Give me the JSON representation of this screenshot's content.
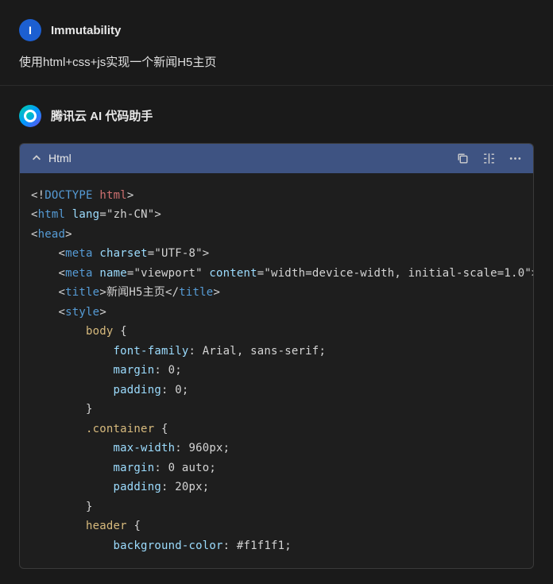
{
  "user": {
    "avatar_letter": "I",
    "name": "Immutability",
    "message": "使用html+css+js实现一个新闻H5主页"
  },
  "ai": {
    "name": "腾讯云 AI 代码助手"
  },
  "code_block": {
    "language": "Html",
    "lines": [
      {
        "indent": 0,
        "tokens": [
          [
            "tag-bracket",
            "<!"
          ],
          [
            "tag-name",
            "DOCTYPE"
          ],
          [
            "text-content",
            " "
          ],
          [
            "doctype-kw",
            "html"
          ],
          [
            "tag-bracket",
            ">"
          ]
        ]
      },
      {
        "indent": 0,
        "tokens": [
          [
            "tag-bracket",
            "<"
          ],
          [
            "tag-name",
            "html"
          ],
          [
            "text-content",
            " "
          ],
          [
            "attr-name",
            "lang"
          ],
          [
            "attr-value",
            "=\"zh-CN\""
          ],
          [
            "tag-bracket",
            ">"
          ]
        ]
      },
      {
        "indent": 0,
        "tokens": [
          [
            "tag-bracket",
            "<"
          ],
          [
            "tag-name",
            "head"
          ],
          [
            "tag-bracket",
            ">"
          ]
        ]
      },
      {
        "indent": 1,
        "tokens": [
          [
            "tag-bracket",
            "<"
          ],
          [
            "tag-name",
            "meta"
          ],
          [
            "text-content",
            " "
          ],
          [
            "attr-name",
            "charset"
          ],
          [
            "attr-value",
            "=\"UTF-8\""
          ],
          [
            "tag-bracket",
            ">"
          ]
        ]
      },
      {
        "indent": 1,
        "tokens": [
          [
            "tag-bracket",
            "<"
          ],
          [
            "tag-name",
            "meta"
          ],
          [
            "text-content",
            " "
          ],
          [
            "attr-name",
            "name"
          ],
          [
            "attr-value",
            "=\"viewport\""
          ],
          [
            "text-content",
            " "
          ],
          [
            "attr-name",
            "content"
          ],
          [
            "attr-value",
            "=\"width=device-width, initial-scale=1.0\""
          ],
          [
            "tag-bracket",
            ">"
          ]
        ]
      },
      {
        "indent": 1,
        "tokens": [
          [
            "tag-bracket",
            "<"
          ],
          [
            "tag-name",
            "title"
          ],
          [
            "tag-bracket",
            ">"
          ],
          [
            "text-content",
            "新闻H5主页"
          ],
          [
            "tag-bracket",
            "</"
          ],
          [
            "tag-name",
            "title"
          ],
          [
            "tag-bracket",
            ">"
          ]
        ]
      },
      {
        "indent": 1,
        "tokens": [
          [
            "tag-bracket",
            "<"
          ],
          [
            "tag-name",
            "style"
          ],
          [
            "tag-bracket",
            ">"
          ]
        ]
      },
      {
        "indent": 2,
        "tokens": [
          [
            "css-selector",
            "body"
          ],
          [
            "text-content",
            " "
          ],
          [
            "css-brace",
            "{"
          ]
        ]
      },
      {
        "indent": 3,
        "tokens": [
          [
            "css-prop",
            "font-family"
          ],
          [
            "css-punct",
            ":"
          ],
          [
            "css-val",
            " Arial, sans-serif"
          ],
          [
            "css-punct",
            ";"
          ]
        ]
      },
      {
        "indent": 3,
        "tokens": [
          [
            "css-prop",
            "margin"
          ],
          [
            "css-punct",
            ":"
          ],
          [
            "css-val",
            " 0"
          ],
          [
            "css-punct",
            ";"
          ]
        ]
      },
      {
        "indent": 3,
        "tokens": [
          [
            "css-prop",
            "padding"
          ],
          [
            "css-punct",
            ":"
          ],
          [
            "css-val",
            " 0"
          ],
          [
            "css-punct",
            ";"
          ]
        ]
      },
      {
        "indent": 2,
        "tokens": [
          [
            "css-brace",
            "}"
          ]
        ]
      },
      {
        "indent": 2,
        "tokens": [
          [
            "css-selector",
            ".container"
          ],
          [
            "text-content",
            " "
          ],
          [
            "css-brace",
            "{"
          ]
        ]
      },
      {
        "indent": 3,
        "tokens": [
          [
            "css-prop",
            "max-width"
          ],
          [
            "css-punct",
            ":"
          ],
          [
            "css-val",
            " 960px"
          ],
          [
            "css-punct",
            ";"
          ]
        ]
      },
      {
        "indent": 3,
        "tokens": [
          [
            "css-prop",
            "margin"
          ],
          [
            "css-punct",
            ":"
          ],
          [
            "css-val",
            " 0 auto"
          ],
          [
            "css-punct",
            ";"
          ]
        ]
      },
      {
        "indent": 3,
        "tokens": [
          [
            "css-prop",
            "padding"
          ],
          [
            "css-punct",
            ":"
          ],
          [
            "css-val",
            " 20px"
          ],
          [
            "css-punct",
            ";"
          ]
        ]
      },
      {
        "indent": 2,
        "tokens": [
          [
            "css-brace",
            "}"
          ]
        ]
      },
      {
        "indent": 2,
        "tokens": [
          [
            "css-selector",
            "header"
          ],
          [
            "text-content",
            " "
          ],
          [
            "css-brace",
            "{"
          ]
        ]
      },
      {
        "indent": 3,
        "tokens": [
          [
            "css-prop",
            "background-color"
          ],
          [
            "css-punct",
            ":"
          ],
          [
            "css-val",
            " #f1f1f1"
          ],
          [
            "css-punct",
            ";"
          ]
        ]
      }
    ]
  }
}
